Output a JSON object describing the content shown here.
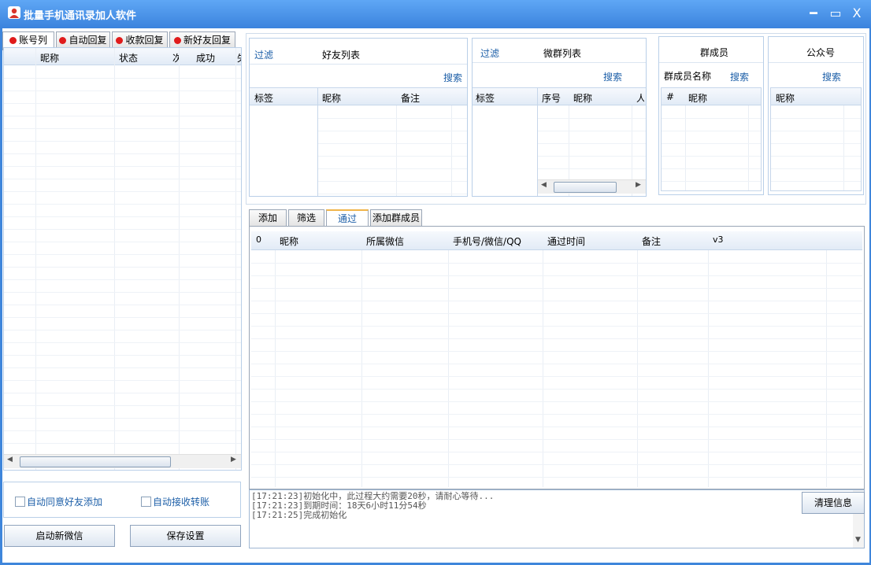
{
  "window": {
    "title": "批量手机通讯录加人软件",
    "controls": {
      "minimize": "━",
      "maximize": "▭",
      "close": "X"
    }
  },
  "left_tabs": [
    {
      "label": "账号列",
      "active": true
    },
    {
      "label": "自动回复",
      "active": false
    },
    {
      "label": "收款回复",
      "active": false
    },
    {
      "label": "新好友回复",
      "active": false
    }
  ],
  "account_table": {
    "columns": [
      "昵称",
      "状态",
      "次",
      "成功",
      "失"
    ]
  },
  "options": {
    "auto_accept_friend": "自动同意好友添加",
    "auto_receive_transfer": "自动接收转账"
  },
  "buttons": {
    "start_wechat": "启动新微信",
    "save_settings": "保存设置",
    "clear_info": "清理信息"
  },
  "friends_panel": {
    "filter": "过滤",
    "title": "好友列表",
    "search": "搜索",
    "columns": [
      "标签",
      "昵称",
      "备注"
    ]
  },
  "groups_panel": {
    "filter": "过滤",
    "title": "微群列表",
    "search": "搜索",
    "columns": [
      "标签",
      "序号",
      "昵称",
      "人"
    ]
  },
  "members_panel": {
    "title": "群成员",
    "name_label": "群成员名称",
    "search": "搜索",
    "columns": [
      "#",
      "昵称"
    ]
  },
  "official_panel": {
    "title": "公众号",
    "search": "搜索",
    "columns": [
      "昵称"
    ]
  },
  "main_tabs": [
    {
      "label": "添加",
      "active": false
    },
    {
      "label": "筛选",
      "active": false
    },
    {
      "label": "通过",
      "active": true
    },
    {
      "label": "添加群成员",
      "active": false
    }
  ],
  "main_table": {
    "columns": [
      "0",
      "昵称",
      "所属微信",
      "手机号/微信/QQ",
      "通过时间",
      "备注",
      "v3"
    ]
  },
  "log": [
    "[17:21:23]初始化中，此过程大约需要20秒，请耐心等待...",
    "[17:21:23]到期时间：18天6小时11分54秒",
    "[17:21:25]完成初始化"
  ]
}
